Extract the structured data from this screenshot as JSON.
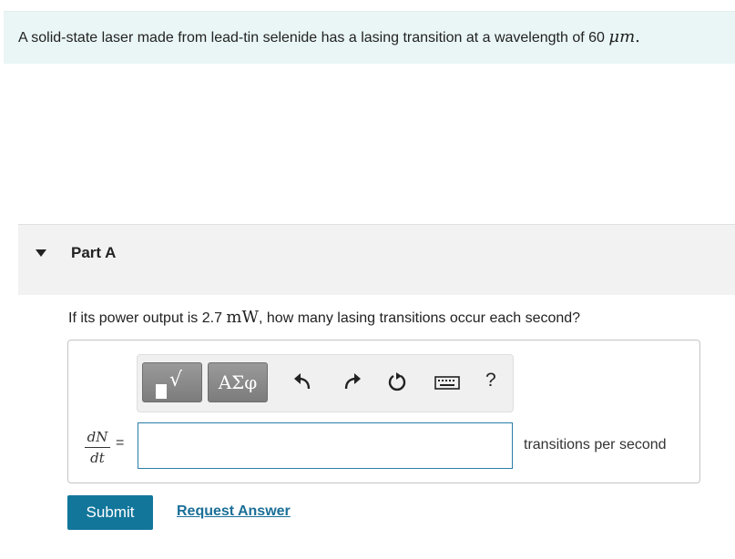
{
  "problem": {
    "text_before": "A solid-state laser made from lead-tin selenide has a lasing transition at a wavelength of 60 ",
    "unit": "μm",
    "text_after": "."
  },
  "part": {
    "title": "Part A"
  },
  "question": {
    "text_before": "If its power output is 2.7 ",
    "unit": "mW",
    "text_after": ", how many lasing transitions occur each second?"
  },
  "toolbar": {
    "templates_symbol": "√",
    "greek_label": "ΑΣφ",
    "icons": [
      "templates-icon",
      "greek-symbols-icon",
      "undo-icon",
      "redo-icon",
      "reset-icon",
      "keyboard-icon",
      "help-icon"
    ],
    "help_label": "?"
  },
  "answer": {
    "lhs_numerator": "dN",
    "lhs_denominator": "dt",
    "equals": "=",
    "value": "",
    "units": "transitions per second"
  },
  "actions": {
    "submit_label": "Submit",
    "request_answer_label": "Request Answer"
  },
  "colors": {
    "banner_bg": "#eaf6f6",
    "part_header_bg": "#f2f2f2",
    "submit_bg": "#12769b",
    "link": "#1b6f98",
    "input_border": "#2a7da8"
  }
}
